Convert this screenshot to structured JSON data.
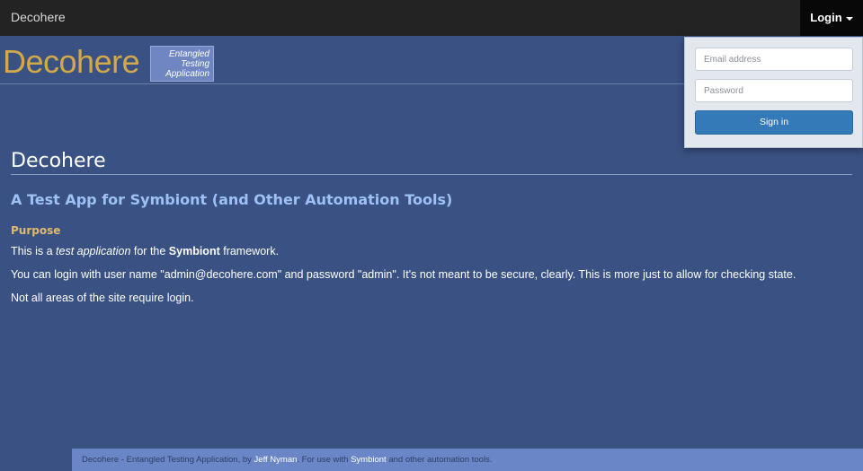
{
  "navbar": {
    "brand": "Decohere",
    "login_label": "Login"
  },
  "logo": {
    "text": "Decohere",
    "badge_lines": [
      "Entangled",
      "Testing",
      "Application"
    ]
  },
  "page": {
    "title": "Decohere",
    "subtitle": "A Test App for Symbiont (and Other Automation Tools)",
    "section_heading": "Purpose",
    "p1": {
      "prefix": "This is a ",
      "em": "test application",
      "middle": " for the ",
      "strong": "Symbiont",
      "suffix": " framework."
    },
    "p2": "You can login with user name \"admin@decohere.com\" and password \"admin\". It's not meant to be secure, clearly. This is more just to allow for checking state.",
    "p3": "Not all areas of the site require login."
  },
  "login_form": {
    "email_placeholder": "Email address",
    "password_placeholder": "Password",
    "submit_label": "Sign in"
  },
  "footer": {
    "prefix": "Decohere - Entangled Testing Application, by ",
    "author_link": "Jeff Nyman",
    "middle": ". For use with ",
    "tool_link": "Symbiont",
    "suffix": " and other automation tools."
  },
  "colors": {
    "background": "#3a5283",
    "navbar": "#232323",
    "logo_gold": "#d3a84a",
    "subtitle_blue": "#9ec1f5",
    "heading_orange": "#e2b870",
    "button_blue": "#3479b8",
    "footer_bg": "#6b86c6"
  },
  "icons": {
    "login_caret": "caret-down-icon"
  }
}
